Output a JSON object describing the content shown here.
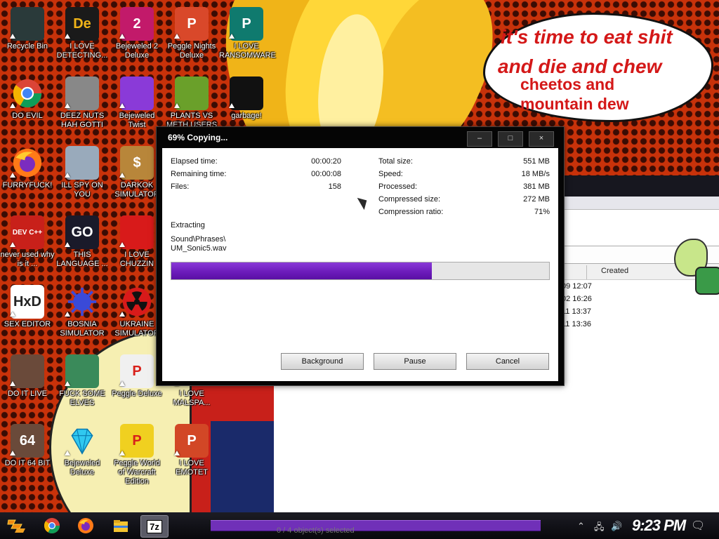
{
  "wallpaper": {
    "bubble": [
      "it's time to eat shit",
      "and die and chew",
      "cheetos and",
      "mountain dew"
    ]
  },
  "desktop_icons": [
    {
      "label": "Recycle Bin",
      "icon": "recycle-bin-icon"
    },
    {
      "label": "I LOVE DETECTING...",
      "icon": "de-app-icon"
    },
    {
      "label": "Bejeweled 2 Deluxe",
      "icon": "bejeweled-2-icon"
    },
    {
      "label": "Peggle Nights Deluxe",
      "icon": "peggle-nights-icon"
    },
    {
      "label": "I LOVE RANSOMWARE",
      "icon": "publisher-icon"
    },
    {
      "label": "DO EVIL",
      "icon": "chrome-icon"
    },
    {
      "label": "DEEZ NUTS HAH GOTTI",
      "icon": "windows-stack-icon"
    },
    {
      "label": "Bejeweled Twist",
      "icon": "bejeweled-twist-icon"
    },
    {
      "label": "PLANTS VS METH USERS",
      "icon": "plants-vs-zombies-icon"
    },
    {
      "label": "garbage!",
      "icon": "garbage-emblem-icon"
    },
    {
      "label": "FURRYFUCK!",
      "icon": "firefox-icon"
    },
    {
      "label": "ILL SPY ON YOU",
      "icon": "network-spy-icon"
    },
    {
      "label": "DARKOK SIMULATOR",
      "icon": "money-bag-icon"
    },
    {
      "label": "never used why is it ...",
      "icon": "devcpp-icon"
    },
    {
      "label": "THIS LANGUAGE ...",
      "icon": "go-language-icon"
    },
    {
      "label": "I LOVE CHUZZIN",
      "icon": "chuzzle-icon"
    },
    {
      "label": "SEX EDITOR",
      "icon": "hxd-icon"
    },
    {
      "label": "BOSNIA SIMULATOR",
      "icon": "spiked-mine-icon"
    },
    {
      "label": "UKRAINE SIMULATOR",
      "icon": "radiation-icon"
    },
    {
      "label": "DO IT LIVE",
      "icon": "portrait-icon"
    },
    {
      "label": "FUCK SOME ELVES",
      "icon": "elf-icon"
    },
    {
      "label": "Peggle Deluxe",
      "icon": "peggle-icon"
    },
    {
      "label": "I LOVE MALSPA...",
      "icon": "blank-icon"
    },
    {
      "label": "DO IT 64 BIT",
      "icon": "portrait-64-icon"
    },
    {
      "label": "Bejeweled Deluxe",
      "icon": "bejeweled-diamond-icon"
    },
    {
      "label": "Peggle World of Warcraft Edition",
      "icon": "peggle-wow-icon"
    },
    {
      "label": "I LOVE EMOTET",
      "icon": "powerpoint-icon"
    }
  ],
  "explorer": {
    "column_partial": "d",
    "column_created": "Created",
    "dates": [
      "09 12:07",
      "02 16:26",
      "11 13:37",
      "11 13:36"
    ],
    "status": "0 / 4 object(s) selected"
  },
  "dialog": {
    "title": "69% Copying...",
    "progress_percent": 69,
    "min_label": "–",
    "max_label": "□",
    "close_label": "×",
    "left_stats": [
      {
        "label": "Elapsed time:",
        "value": "00:00:20"
      },
      {
        "label": "Remaining time:",
        "value": "00:00:08"
      },
      {
        "label": "Files:",
        "value": "158"
      }
    ],
    "right_stats": [
      {
        "label": "Total size:",
        "value": "551 MB"
      },
      {
        "label": "Speed:",
        "value": "18 MB/s"
      },
      {
        "label": "Processed:",
        "value": "381 MB"
      },
      {
        "label": "Compressed size:",
        "value": "272 MB"
      },
      {
        "label": "Compression ratio:",
        "value": "71%"
      }
    ],
    "operation": "Extracting",
    "path_line_1": "Sound\\Phrases\\",
    "path_line_2": "UM_Sonic5.wav",
    "buttons": {
      "background": "Background",
      "pause": "Pause",
      "cancel": "Cancel"
    }
  },
  "taskbar": {
    "start_icon": "start-logo-icon",
    "items": [
      "chrome-icon",
      "firefox-icon",
      "file-explorer-icon",
      "7zip-icon"
    ],
    "seven_zip_label": "7z",
    "clock": "9:23 PM"
  }
}
